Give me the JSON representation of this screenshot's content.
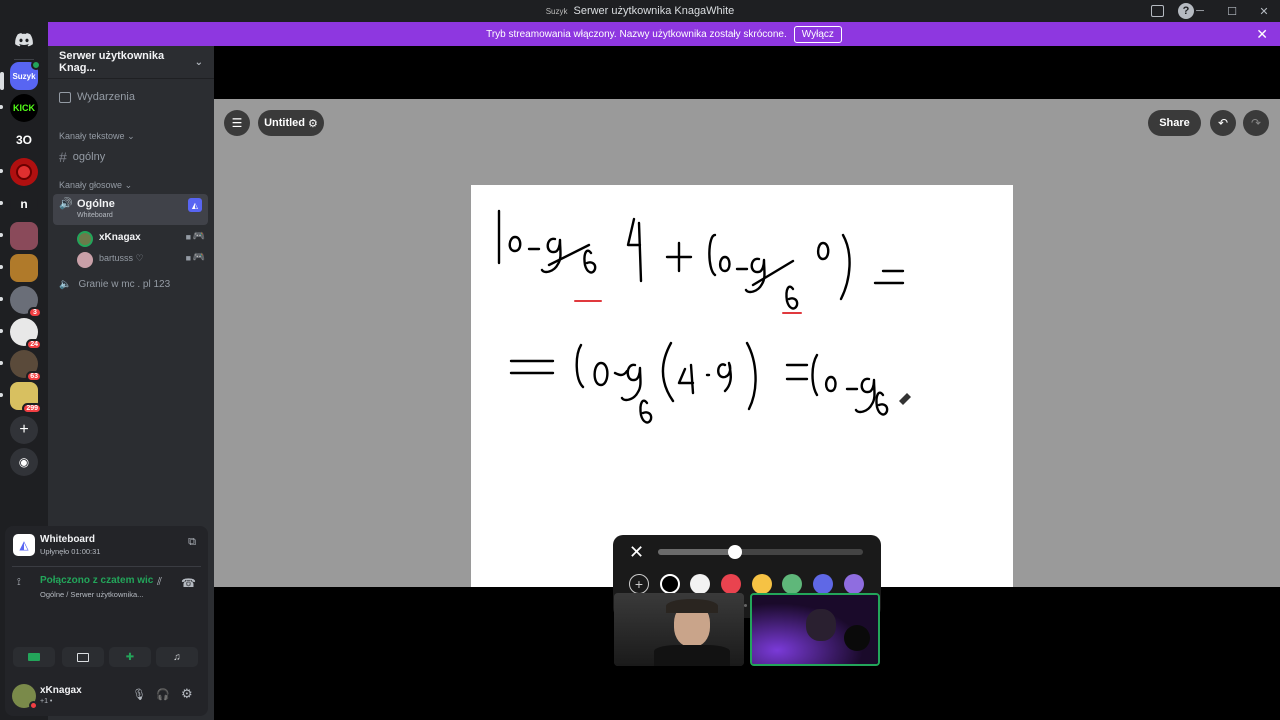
{
  "window": {
    "title": "Serwer użytkownika KnagaWhite",
    "title_prefix": "Suzyk"
  },
  "banner": {
    "text": "Tryb streamowania włączony. Nazwy użytkownika zostały skrócone.",
    "off_label": "Wyłącz"
  },
  "guilds": {
    "suzyk_label": "Suzyk",
    "kick_label": "KICK",
    "thirty_label": "3O",
    "n_label": "n",
    "badges": [
      "3",
      "24",
      "63",
      "299"
    ]
  },
  "sidebar": {
    "server_name": "Serwer użytkownika Knag...",
    "events_label": "Wydarzenia",
    "text_category": "Kanały tekstowe",
    "text_channel": "ogólny",
    "voice_category": "Kanały głosowe",
    "voice_channel": "Ogólne",
    "voice_activity": "Whiteboard",
    "voice_users": [
      "xKnagax",
      "bartusss ♡"
    ],
    "voice_channel_2": "Granie w mc . pl 123"
  },
  "user_panel": {
    "activity_title": "Whiteboard",
    "activity_time": "Upłynęło 01:00:31",
    "connection_status": "Połączono z czatem wic",
    "connection_path": "Ogólne / Serwer użytkownika...",
    "username": "xKnagax",
    "user_status": "+1 •"
  },
  "whiteboard": {
    "board_title": "Untitled",
    "share_label": "Share"
  },
  "colors": {
    "accent_purple": "#8e37e0",
    "connected_green": "#23a55a",
    "palette": [
      "#000000",
      "#f2f2f2",
      "#e9434f",
      "#f6c244",
      "#5fb77a",
      "#5f68e6",
      "#8f6de0"
    ]
  }
}
